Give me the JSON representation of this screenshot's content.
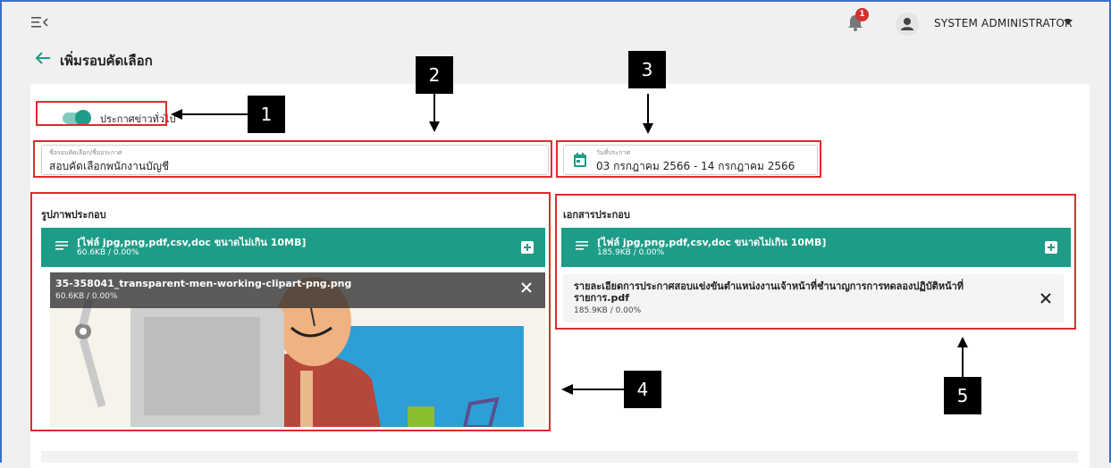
{
  "header": {
    "notification_count": "1",
    "user_name": "SYSTEM ADMINISTRATOR",
    "page_title": "เพิ่มรอบคัดเลือก"
  },
  "form": {
    "toggle_label": "ประกาศข่าวทั่วไป",
    "toggle_on": true,
    "name_field": {
      "label": "ชื่อรอบคัดเลือก/ชื่อประกาศ",
      "value": "สอบคัดเลือกพนักงานบัญชี"
    },
    "date_field": {
      "label": "วันที่ประกาศ",
      "value": "03 กรกฎาคม 2566 - 14 กรกฎาคม 2566"
    }
  },
  "images_section": {
    "title": "รูปภาพประกอบ",
    "uploader_title": "[ไฟล์ jpg,png,pdf,csv,doc ขนาดไม่เกิน 10MB]",
    "uploader_sub": "60.6KB / 0.00%",
    "file": {
      "name": "35-358041_transparent-men-working-clipart-png.png",
      "size": "60.6KB / 0.00%"
    }
  },
  "docs_section": {
    "title": "เอกสารประกอบ",
    "uploader_title": "[ไฟล์ jpg,png,pdf,csv,doc ขนาดไม่เกิน 10MB]",
    "uploader_sub": "185.9KB / 0.00%",
    "file": {
      "name": "รายละเอียดการประกาศสอบแข่งขันตำแหน่งงานเจ้าหน้าที่ชำนาญการการทดลองปฏิบัติหน้าที่ รายการ.pdf",
      "size": "185.9KB / 0.00%"
    }
  },
  "annotations": [
    "1",
    "2",
    "3",
    "4",
    "5"
  ],
  "colors": {
    "accent": "#1d9d87",
    "annotation_red": "#e02b2b",
    "badge": "#d32f2f"
  },
  "icons": [
    "menu-collapse-icon",
    "bell-icon",
    "user-icon",
    "back-arrow-icon",
    "calendar-icon",
    "list-icon",
    "plus-icon",
    "close-icon"
  ]
}
